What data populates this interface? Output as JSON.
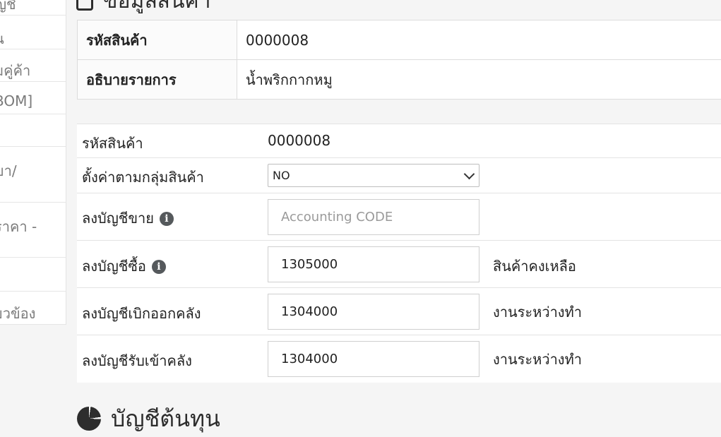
{
  "sidebar": {
    "items": [
      {
        "label": "ญชี"
      },
      {
        "label": "น"
      },
      {
        "label": "มคู่ค้า"
      },
      {
        "label": "BOM]"
      },
      {
        "label": ""
      },
      {
        "label": "ขา/"
      },
      {
        "label": "ราคา -"
      },
      {
        "label": ""
      },
      {
        "label": "ยวข้อง"
      }
    ]
  },
  "top_heading": {
    "title": "ข้อมูลสินค้า",
    "icon": "document-icon"
  },
  "info": {
    "rows": [
      {
        "label": "รหัสสินค้า",
        "value": "0000008"
      },
      {
        "label": "อธิบายรายการ",
        "value": "น้ำพริกกากหมู"
      }
    ]
  },
  "form": {
    "code_label": "รหัสสินค้า",
    "code_value": "0000008",
    "group_label": "ตั้งค่าตามกลุ่มสินค้า",
    "group_selected": "NO",
    "sales_label": "ลงบัญชีขาย",
    "sales_placeholder": "Accounting CODE",
    "sales_value": "",
    "purchase_label": "ลงบัญชีซื้อ",
    "purchase_value": "1305000",
    "purchase_desc": "สินค้าคงเหลือ",
    "withdraw_label": "ลงบัญชีเบิกออกคลัง",
    "withdraw_value": "1304000",
    "withdraw_desc": "งานระหว่างทำ",
    "receive_label": "ลงบัญชีรับเข้าคลัง",
    "receive_value": "1304000",
    "receive_desc": "งานระหว่างทำ",
    "info_icon": "i"
  },
  "bottom_heading": {
    "title": "บัญชีต้นทุน",
    "icon": "pie-chart-icon"
  }
}
